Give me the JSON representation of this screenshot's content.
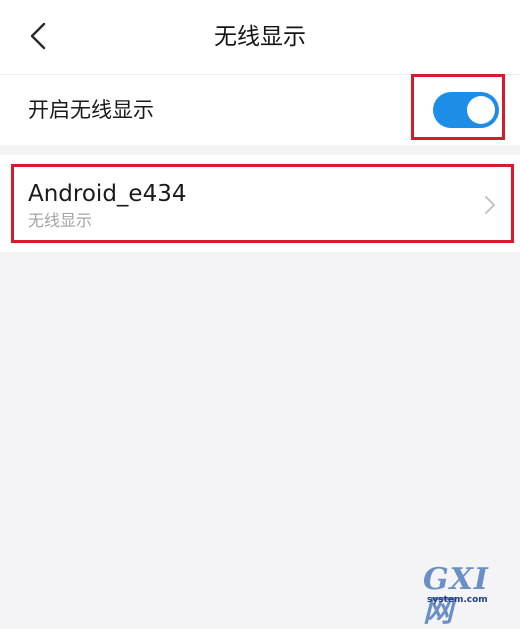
{
  "header": {
    "title": "无线显示",
    "back_icon": "chevron-left-icon"
  },
  "wireless_display": {
    "label": "开启无线显示",
    "enabled": true,
    "accent_color": "#1d8ee8"
  },
  "devices": [
    {
      "name": "Android_e434",
      "subtitle": "无线显示"
    }
  ],
  "annotation_color": "#d41c2c",
  "watermark": {
    "logo": "GXI网",
    "url": "system.com"
  }
}
